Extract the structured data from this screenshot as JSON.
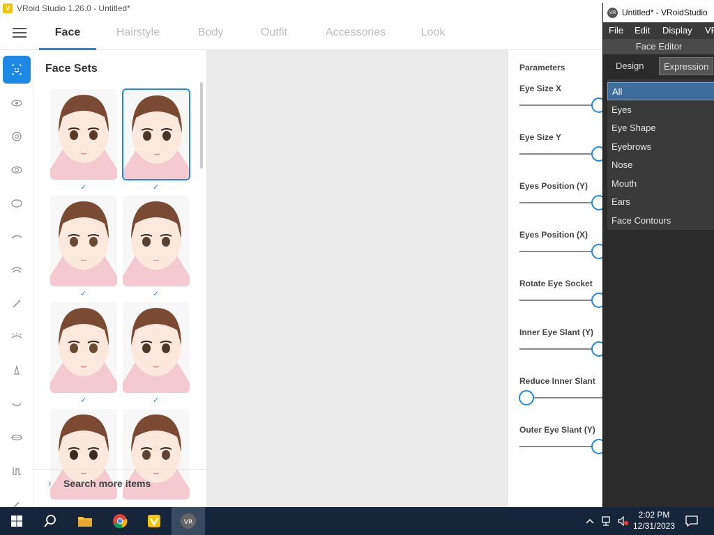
{
  "window": {
    "title": "VRoid Studio 1.26.0 - Untitled*"
  },
  "tabs": [
    {
      "label": "Face"
    },
    {
      "label": "Hairstyle"
    },
    {
      "label": "Body"
    },
    {
      "label": "Outfit"
    },
    {
      "label": "Accessories"
    },
    {
      "label": "Look"
    }
  ],
  "face_panel": {
    "title": "Face Sets",
    "search_more": "Search more items"
  },
  "params": {
    "title": "Parameters",
    "items": [
      {
        "label": "Eye Size X",
        "value": 1.0
      },
      {
        "label": "Eye Size Y",
        "value": 1.0
      },
      {
        "label": "Eyes Position (Y)",
        "value": 1.0
      },
      {
        "label": "Eyes Position (X)",
        "value": 1.0
      },
      {
        "label": "Rotate Eye Socket",
        "value": 1.0
      },
      {
        "label": "Inner Eye Slant (Y)",
        "value": 1.0
      },
      {
        "label": "Reduce Inner Slant",
        "value": 0.0
      },
      {
        "label": "Outer Eye Slant (Y)",
        "value": 1.0
      }
    ]
  },
  "face_editor": {
    "window_title": "Untitled* - VRoidStudio",
    "menu": [
      "File",
      "Edit",
      "Display",
      "VR"
    ],
    "header": "Face Editor",
    "tabs": [
      "Design",
      "Expression"
    ],
    "list": [
      "All",
      "Eyes",
      "Eye Shape",
      "Eyebrows",
      "Nose",
      "Mouth",
      "Ears",
      "Face Contours"
    ]
  },
  "taskbar": {
    "time": "2:02 PM",
    "date": "12/31/2023"
  },
  "colors": {
    "accent": "#1e88e5",
    "taskbar": "#17253a"
  }
}
